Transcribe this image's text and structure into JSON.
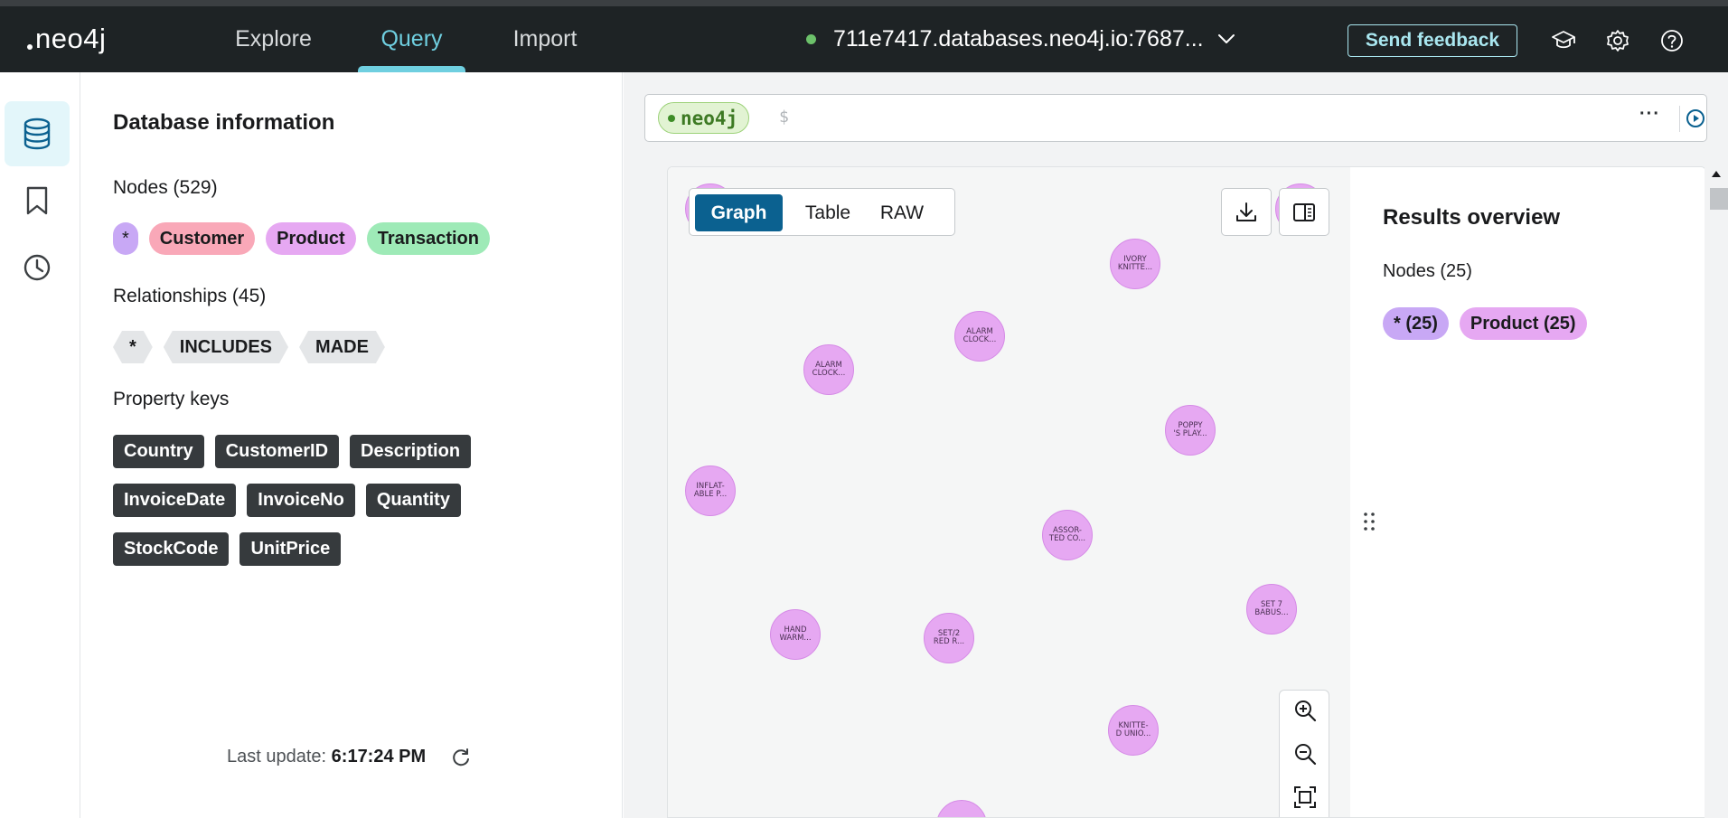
{
  "app": {
    "logo_text": "neo4j",
    "nav_tabs": [
      {
        "label": "Explore",
        "active": false
      },
      {
        "label": "Query",
        "active": true
      },
      {
        "label": "Import",
        "active": false
      }
    ],
    "connection": {
      "status_color": "#6cc16a",
      "host": "711e7417.databases.neo4j.io:7687..."
    },
    "feedback_label": "Send feedback",
    "top_icons": [
      "graduation-cap-icon",
      "gear-icon",
      "help-icon"
    ]
  },
  "rail": {
    "items": [
      {
        "icon": "database-icon",
        "active": true
      },
      {
        "icon": "bookmark-icon",
        "active": false
      },
      {
        "icon": "history-icon",
        "active": false
      }
    ]
  },
  "db_info": {
    "title": "Database information",
    "nodes_label": "Nodes (529)",
    "node_labels": [
      {
        "text": "*",
        "color": "#c8a8f5"
      },
      {
        "text": "Customer",
        "color": "#f9a8b8"
      },
      {
        "text": "Product",
        "color": "#e6a8f2"
      },
      {
        "text": "Transaction",
        "color": "#9eeab7"
      }
    ],
    "relationships_label": "Relationships (45)",
    "relationship_types": [
      "*",
      "INCLUDES",
      "MADE"
    ],
    "property_keys_label": "Property keys",
    "property_keys": [
      "Country",
      "CustomerID",
      "Description",
      "InvoiceDate",
      "InvoiceNo",
      "Quantity",
      "StockCode",
      "UnitPrice"
    ],
    "last_update_prefix": "Last update:",
    "last_update_time": "6:17:24 PM"
  },
  "editor": {
    "db_name": "neo4j",
    "prompt": "$",
    "more_label": "···"
  },
  "result": {
    "view_tabs": [
      {
        "label": "Graph",
        "active": true
      },
      {
        "label": "Table",
        "active": false
      },
      {
        "label": "RAW",
        "active": false
      }
    ],
    "nodes": [
      {
        "text": "IVORY\nKNITTE..."
      },
      {
        "text": "ALARM\nCLOCK..."
      },
      {
        "text": "ALARM\nCLOCK..."
      },
      {
        "text": "POPPY\n'S PLAY..."
      },
      {
        "text": "INFLAT-\nABLE P..."
      },
      {
        "text": "ASSOR-\nTED CO..."
      },
      {
        "text": "SET 7\nBABUS..."
      },
      {
        "text": "HAND\nWARM..."
      },
      {
        "text": "SET/2\nRED R..."
      },
      {
        "text": "KNITTE-\nD UNIO..."
      },
      {
        "text": ""
      },
      {
        "text": ""
      },
      {
        "text": ""
      }
    ],
    "overview": {
      "title": "Results overview",
      "nodes_label": "Nodes (25)",
      "chips": [
        {
          "text": "* (25)",
          "color": "#c8a8f5"
        },
        {
          "text": "Product (25)",
          "color": "#e6a8f2"
        }
      ]
    }
  }
}
